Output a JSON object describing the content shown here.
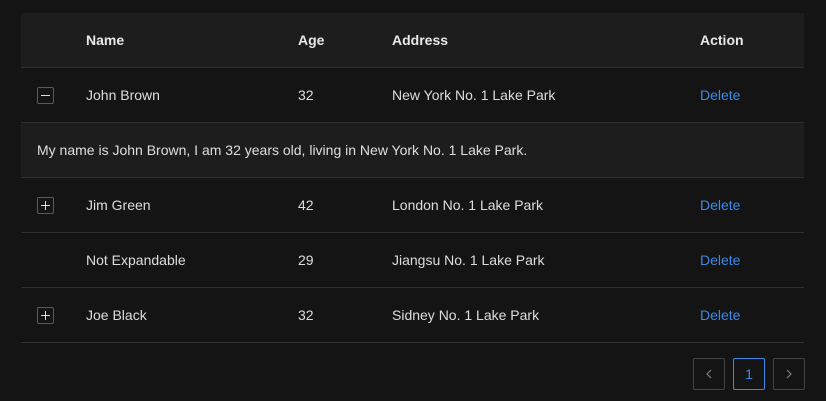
{
  "table": {
    "columns": {
      "name": "Name",
      "age": "Age",
      "address": "Address",
      "action": "Action"
    },
    "rows": [
      {
        "name": "John Brown",
        "age": "32",
        "address": "New York No. 1 Lake Park",
        "action": "Delete",
        "expand": "expanded",
        "description": "My name is John Brown, I am 32 years old, living in New York No. 1 Lake Park."
      },
      {
        "name": "Jim Green",
        "age": "42",
        "address": "London No. 1 Lake Park",
        "action": "Delete",
        "expand": "collapsed"
      },
      {
        "name": "Not Expandable",
        "age": "29",
        "address": "Jiangsu No. 1 Lake Park",
        "action": "Delete",
        "expand": "none"
      },
      {
        "name": "Joe Black",
        "age": "32",
        "address": "Sidney No. 1 Lake Park",
        "action": "Delete",
        "expand": "collapsed"
      }
    ]
  },
  "pagination": {
    "prev_icon": "chevron-left-icon",
    "current_page": "1",
    "next_icon": "chevron-right-icon"
  },
  "colors": {
    "link": "#3c89e8",
    "background": "#141414",
    "header": "#1d1d1d",
    "border": "#303030"
  }
}
